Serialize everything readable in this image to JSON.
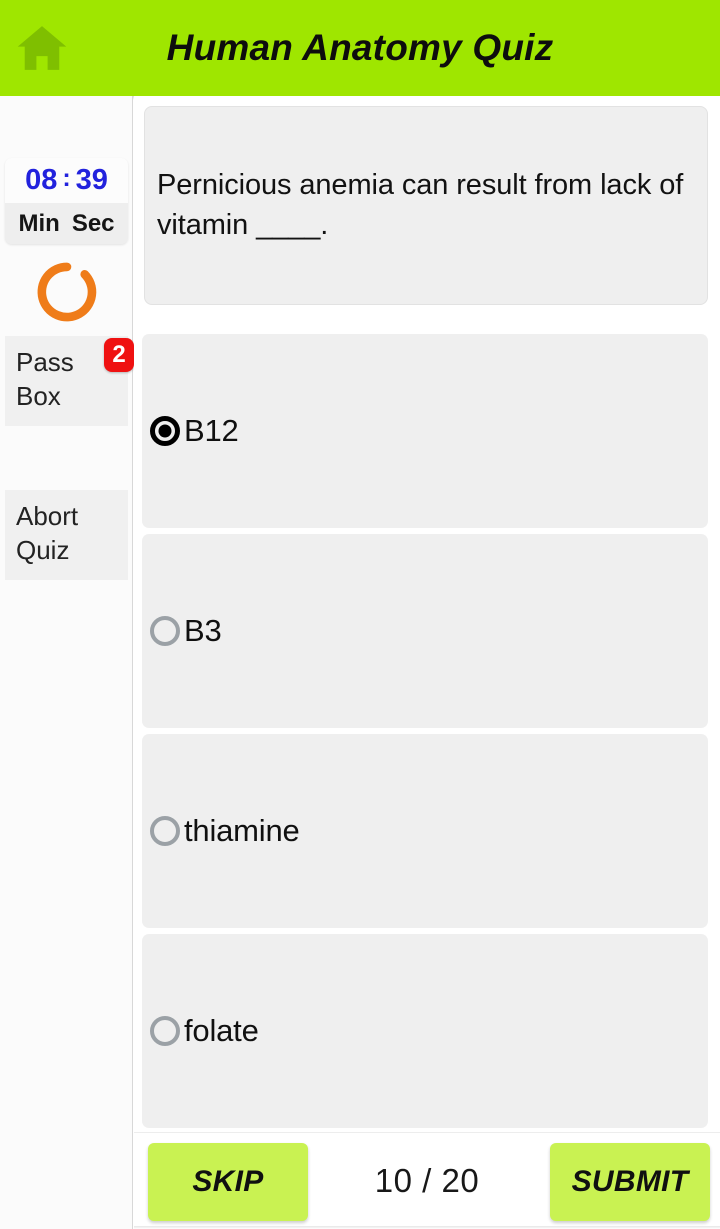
{
  "header": {
    "title": "Human Anatomy Quiz",
    "home_icon": "home-icon",
    "background_color": "#9fe600",
    "title_color": "#0d0d0d"
  },
  "sidebar": {
    "timer": {
      "minutes": "08",
      "separator": ":",
      "seconds": "39",
      "minutes_label": "Min",
      "seconds_label": "Sec",
      "digit_color": "#2222dd"
    },
    "spinner": {
      "icon": "loading-spinner-icon",
      "color": "#ef7c19"
    },
    "pass_box": {
      "label": "Pass Box",
      "badge_count": "2",
      "badge_color": "#ef1111"
    },
    "abort_quiz": {
      "label": "Abort Quiz"
    }
  },
  "main": {
    "question": "Pernicious anemia can result from lack of vitamin ____.",
    "options": [
      {
        "label": "B12",
        "selected": true
      },
      {
        "label": "B3",
        "selected": false
      },
      {
        "label": "thiamine",
        "selected": false
      },
      {
        "label": "folate",
        "selected": false
      }
    ]
  },
  "footer": {
    "skip_label": "SKIP",
    "submit_label": "SUBMIT",
    "progress": "10 / 20",
    "current_question": "10",
    "total_questions": "20",
    "button_color": "#c9f252"
  }
}
